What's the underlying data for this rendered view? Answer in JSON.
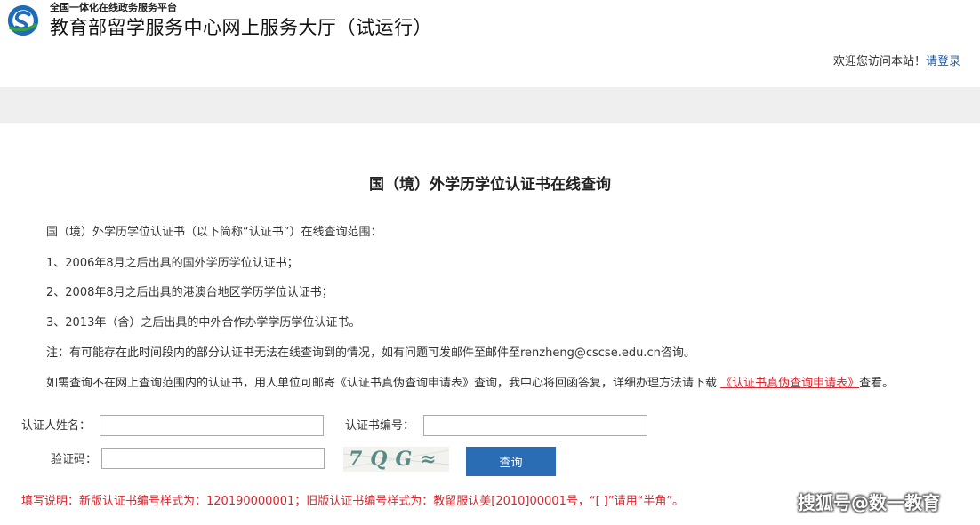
{
  "header": {
    "platform": "全国一体化在线政务服务平台",
    "title": "教育部留学服务中心网上服务大厅（试运行）",
    "welcome_text": "欢迎您访问本站！",
    "login_link": "请登录"
  },
  "main": {
    "page_title": "国（境）外学历学位认证书在线查询",
    "intro": "国（境）外学历学位认证书（以下简称“认证书”）在线查询范围：",
    "items": [
      "1、2006年8月之后出具的国外学历学位认证书；",
      "2、2008年8月之后出具的港澳台地区学历学位认证书；",
      "3、2013年（含）之后出具的中外合作办学学历学位认证书。"
    ],
    "note": "注：有可能存在此时间段内的部分认证书无法在线查询到的情况，如有问题可发邮件至邮件至renzheng@cscse.edu.cn咨询。",
    "mail_note_before": "如需查询不在网上查询范围内的认证书，用人单位可邮寄《认证书真伪查询申请表》查询，我中心将回函答复，详细办理方法请下载",
    "mail_note_link": "《认证书真伪查询申请表》",
    "mail_note_after": "查看。"
  },
  "form": {
    "name_label": "认证人姓名：",
    "name_value": "",
    "cert_label": "认证书编号：",
    "cert_value": "",
    "captcha_label": "验证码：",
    "captcha_value": "",
    "captcha_text": "7QG≈",
    "submit_label": "查询"
  },
  "footer": {
    "fill_note": "填写说明：新版认证书编号样式为：120190000001；旧版认证书编号样式为：教留服认美[2010]00001号，“[ ]”请用“半角”。",
    "watermark": "搜狐号@数一教育"
  },
  "colors": {
    "link_blue": "#1f5fa8",
    "button_blue": "#2a6db5",
    "warning_red": "#d8262e",
    "bar_grey": "#efefef"
  }
}
